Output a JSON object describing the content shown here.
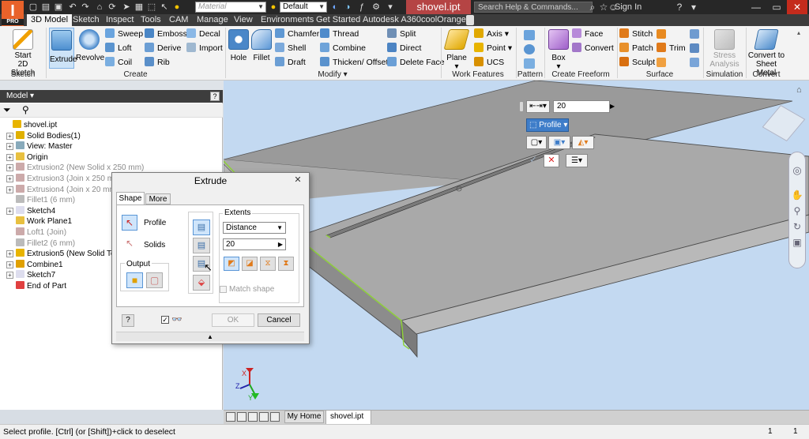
{
  "title_bar": {
    "logo_text": "I",
    "logo_sub": "PRO",
    "material_placeholder": "Material",
    "appearance_value": "Default",
    "file_tab": "shovel.ipt",
    "search_placeholder": "Search Help & Commands...",
    "sign_in": "Sign In"
  },
  "menu_tabs": [
    "3D Model",
    "Sketch",
    "Inspect",
    "Tools",
    "CAM",
    "Manage",
    "View",
    "Environments",
    "Get Started",
    "Autodesk A360",
    "coolOrange"
  ],
  "ribbon": {
    "sketch": {
      "start_line1": "Start",
      "start_line2": "2D Sketch",
      "group": "Sketch"
    },
    "create": {
      "extrude": "Extrude",
      "revolve": "Revolve",
      "sweep": "Sweep",
      "loft": "Loft",
      "coil": "Coil",
      "emboss": "Emboss",
      "derive": "Derive",
      "rib": "Rib",
      "decal": "Decal",
      "import": "Import",
      "group": "Create"
    },
    "modify": {
      "hole": "Hole",
      "fillet": "Fillet",
      "chamfer": "Chamfer",
      "shell": "Shell",
      "draft": "Draft",
      "thread": "Thread",
      "combine": "Combine",
      "thicken": "Thicken/ Offset",
      "split": "Split",
      "direct": "Direct",
      "delete_face": "Delete Face",
      "group": "Modify"
    },
    "work_features": {
      "plane": "Plane",
      "axis": "Axis",
      "point": "Point",
      "ucs": "UCS",
      "group": "Work Features"
    },
    "pattern": {
      "group": "Pattern"
    },
    "freeform": {
      "box": "Box",
      "face": "Face",
      "convert": "Convert",
      "group": "Create Freeform"
    },
    "surface": {
      "stitch": "Stitch",
      "patch": "Patch",
      "sculpt": "Sculpt",
      "trim": "Trim",
      "group": "Surface"
    },
    "simulation": {
      "stress_line1": "Stress",
      "stress_line2": "Analysis",
      "group": "Simulation"
    },
    "convert": {
      "line1": "Convert to",
      "line2": "Sheet Metal",
      "group": "Convert"
    }
  },
  "browser": {
    "header": "Model",
    "items": [
      {
        "label": "shovel.ipt",
        "grey": false,
        "exp": "",
        "indent": 0,
        "icon": "#e8b400"
      },
      {
        "label": "Solid Bodies(1)",
        "grey": false,
        "exp": "+",
        "indent": 1,
        "icon": "#e0b000"
      },
      {
        "label": "View: Master",
        "grey": false,
        "exp": "+",
        "indent": 1,
        "icon": "#8ab"
      },
      {
        "label": "Origin",
        "grey": false,
        "exp": "+",
        "indent": 1,
        "icon": "#e8c040"
      },
      {
        "label": "Extrusion2 (New Solid x 250 mm)",
        "grey": true,
        "exp": "+",
        "indent": 1,
        "icon": "#caa"
      },
      {
        "label": "Extrusion3 (Join x 250 mm)",
        "grey": true,
        "exp": "+",
        "indent": 1,
        "icon": "#caa"
      },
      {
        "label": "Extrusion4 (Join x 20 mm)",
        "grey": true,
        "exp": "+",
        "indent": 1,
        "icon": "#caa"
      },
      {
        "label": "Fillet1 (6 mm)",
        "grey": true,
        "exp": "",
        "indent": 1,
        "icon": "#bbb"
      },
      {
        "label": "Sketch4",
        "grey": false,
        "exp": "+",
        "indent": 1,
        "icon": "#dde"
      },
      {
        "label": "Work Plane1",
        "grey": false,
        "exp": "",
        "indent": 1,
        "icon": "#e8c040"
      },
      {
        "label": "Loft1 (Join)",
        "grey": true,
        "exp": "",
        "indent": 1,
        "icon": "#caa"
      },
      {
        "label": "Fillet2 (6 mm)",
        "grey": true,
        "exp": "",
        "indent": 1,
        "icon": "#bbb"
      },
      {
        "label": "Extrusion5 (New Solid To)",
        "grey": false,
        "exp": "+",
        "indent": 1,
        "icon": "#e8b400"
      },
      {
        "label": "Combine1",
        "grey": false,
        "exp": "+",
        "indent": 1,
        "icon": "#e0a000"
      },
      {
        "label": "Sketch7",
        "grey": false,
        "exp": "+",
        "indent": 1,
        "icon": "#dde"
      },
      {
        "label": "End of Part",
        "grey": false,
        "exp": "",
        "indent": 1,
        "icon": "#e04040"
      }
    ]
  },
  "minitoolbar": {
    "distance": "20",
    "profile": "Profile"
  },
  "dialog": {
    "title": "Extrude",
    "tab_shape": "Shape",
    "tab_more": "More",
    "profile": "Profile",
    "solids": "Solids",
    "output": "Output",
    "extents": "Extents",
    "extents_type": "Distance",
    "distance": "20",
    "match_shape": "Match shape",
    "ok": "OK",
    "cancel": "Cancel"
  },
  "triad": {
    "x": "X",
    "y": "Y",
    "z": "Z"
  },
  "doc_tabs": {
    "home": "My Home",
    "file": "shovel.ipt"
  },
  "status": {
    "message": "Select profile. [Ctrl] (or [Shift])+click to deselect",
    "count1": "1",
    "count2": "1"
  }
}
